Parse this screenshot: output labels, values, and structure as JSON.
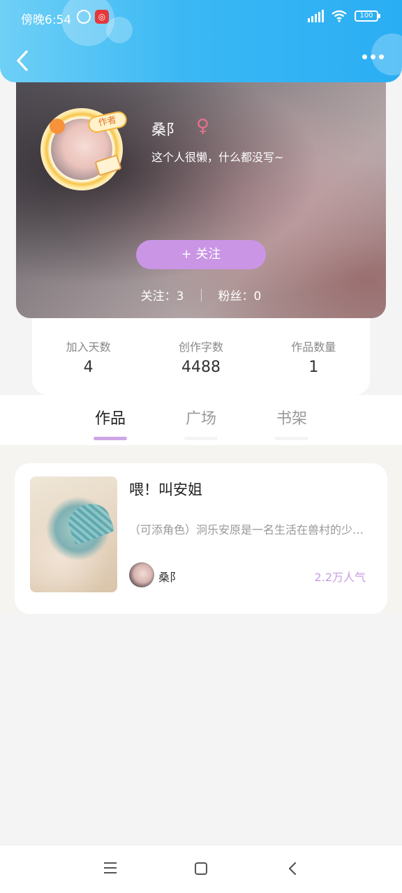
{
  "status_bar": {
    "time": "傍晚6:54",
    "app_badge": "◎",
    "battery": "100"
  },
  "profile": {
    "author_tag": "作者",
    "username": "桑阝",
    "gender_symbol": "♀",
    "bio": "这个人很懒，什么都没写~",
    "follow_button": "+   关注",
    "following": "关注：3",
    "followers": "粉丝：0"
  },
  "stats": [
    {
      "label": "加入天数",
      "value": "4"
    },
    {
      "label": "创作字数",
      "value": "4488"
    },
    {
      "label": "作品数量",
      "value": "1"
    }
  ],
  "tabs": [
    {
      "label": "作品",
      "active": true
    },
    {
      "label": "广场",
      "active": false
    },
    {
      "label": "书架",
      "active": false
    }
  ],
  "works": [
    {
      "title": "喂！叫安姐",
      "description": "（可添角色）泂乐安原是一名生活在兽村的少女，某天",
      "author": "桑阝",
      "popularity": "2.2万人气"
    }
  ],
  "colors": {
    "header_gradient_start": "#6fd0f6",
    "header_gradient_end": "#2aaef3",
    "accent_purple": "#c995e4",
    "gender_pink": "#e8708c"
  }
}
